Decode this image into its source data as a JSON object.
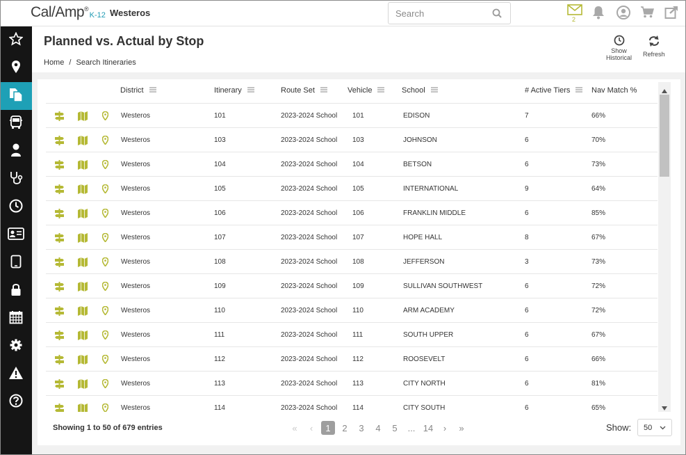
{
  "header": {
    "logo_main": "Cal/Amp",
    "logo_sup": "®",
    "logo_k12": "K-12",
    "org": "Westeros",
    "search_placeholder": "Search",
    "mail_count": "2"
  },
  "sidebar": {
    "items": [
      {
        "icon": "star-icon"
      },
      {
        "icon": "map-pin-icon"
      },
      {
        "icon": "documents-icon",
        "active": true
      },
      {
        "icon": "bus-icon"
      },
      {
        "icon": "student-icon"
      },
      {
        "icon": "stethoscope-icon"
      },
      {
        "icon": "clock-icon"
      },
      {
        "icon": "id-card-icon"
      },
      {
        "icon": "tablet-icon"
      },
      {
        "icon": "lock-icon"
      },
      {
        "icon": "calendar-icon"
      },
      {
        "icon": "gear-icon"
      },
      {
        "icon": "warning-icon"
      },
      {
        "icon": "help-icon"
      }
    ]
  },
  "page": {
    "title": "Planned vs. Actual by Stop",
    "breadcrumb_home": "Home",
    "breadcrumb_sep": "/",
    "breadcrumb_current": "Search Itineraries",
    "show_historical_1": "Show",
    "show_historical_2": "Historical",
    "refresh": "Refresh"
  },
  "table": {
    "columns": {
      "district": "District",
      "itinerary": "Itinerary",
      "route_set": "Route Set",
      "vehicle": "Vehicle",
      "school": "School",
      "tiers": "# Active Tiers",
      "nav": "Nav Match %"
    },
    "rows": [
      {
        "district": "Westeros",
        "itinerary": "101",
        "route_set": "2023-2024 School",
        "vehicle": "101",
        "school": "EDISON",
        "tiers": "7",
        "nav": "66%"
      },
      {
        "district": "Westeros",
        "itinerary": "103",
        "route_set": "2023-2024 School",
        "vehicle": "103",
        "school": "JOHNSON",
        "tiers": "6",
        "nav": "70%"
      },
      {
        "district": "Westeros",
        "itinerary": "104",
        "route_set": "2023-2024 School",
        "vehicle": "104",
        "school": "BETSON",
        "tiers": "6",
        "nav": "73%"
      },
      {
        "district": "Westeros",
        "itinerary": "105",
        "route_set": "2023-2024 School",
        "vehicle": "105",
        "school": "INTERNATIONAL",
        "tiers": "9",
        "nav": "64%"
      },
      {
        "district": "Westeros",
        "itinerary": "106",
        "route_set": "2023-2024 School",
        "vehicle": "106",
        "school": "FRANKLIN MIDDLE",
        "tiers": "6",
        "nav": "85%"
      },
      {
        "district": "Westeros",
        "itinerary": "107",
        "route_set": "2023-2024 School",
        "vehicle": "107",
        "school": "HOPE HALL",
        "tiers": "8",
        "nav": "67%"
      },
      {
        "district": "Westeros",
        "itinerary": "108",
        "route_set": "2023-2024 School",
        "vehicle": "108",
        "school": "JEFFERSON",
        "tiers": "3",
        "nav": "73%"
      },
      {
        "district": "Westeros",
        "itinerary": "109",
        "route_set": "2023-2024 School",
        "vehicle": "109",
        "school": "SULLIVAN SOUTHWEST",
        "tiers": "6",
        "nav": "72%"
      },
      {
        "district": "Westeros",
        "itinerary": "110",
        "route_set": "2023-2024 School",
        "vehicle": "110",
        "school": "ARM ACADEMY",
        "tiers": "6",
        "nav": "72%"
      },
      {
        "district": "Westeros",
        "itinerary": "111",
        "route_set": "2023-2024 School",
        "vehicle": "111",
        "school": "SOUTH UPPER",
        "tiers": "6",
        "nav": "67%"
      },
      {
        "district": "Westeros",
        "itinerary": "112",
        "route_set": "2023-2024 School",
        "vehicle": "112",
        "school": "ROOSEVELT",
        "tiers": "6",
        "nav": "66%"
      },
      {
        "district": "Westeros",
        "itinerary": "113",
        "route_set": "2023-2024 School",
        "vehicle": "113",
        "school": "CITY NORTH",
        "tiers": "6",
        "nav": "81%"
      },
      {
        "district": "Westeros",
        "itinerary": "114",
        "route_set": "2023-2024 School",
        "vehicle": "114",
        "school": "CITY SOUTH",
        "tiers": "6",
        "nav": "65%"
      }
    ]
  },
  "footer": {
    "info": "Showing 1 to 50 of 679 entries",
    "pages": [
      "1",
      "2",
      "3",
      "4",
      "5",
      "...",
      "14"
    ],
    "current_page": "1",
    "show_label": "Show:",
    "page_size": "50"
  },
  "colors": {
    "accent": "#1ea0b6",
    "row_icon": "#b5b935",
    "sidebar": "#151515"
  }
}
